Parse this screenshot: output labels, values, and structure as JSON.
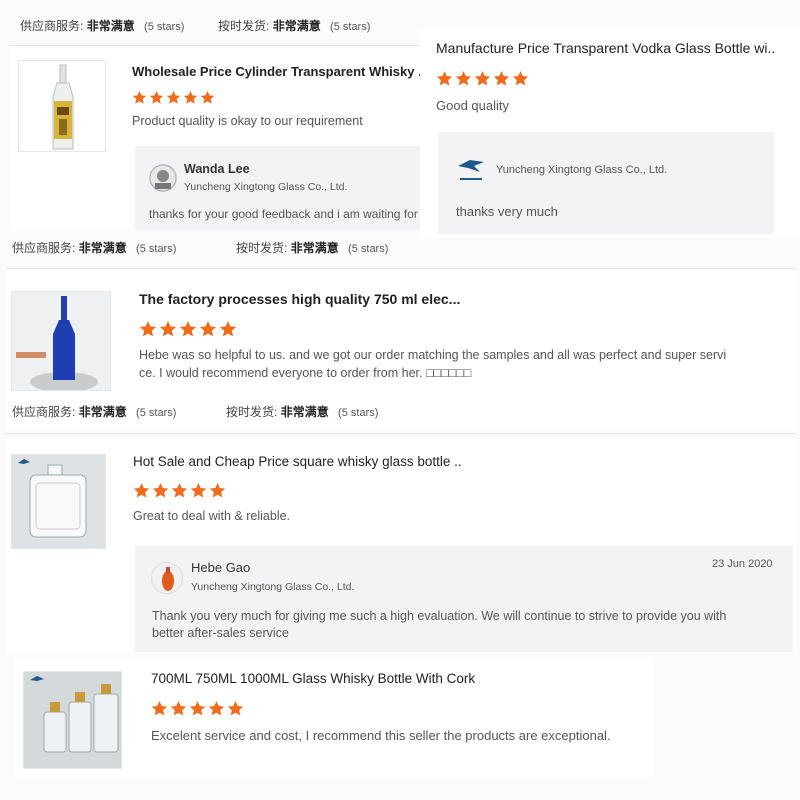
{
  "ratings_bar": {
    "service_label": "供应商服务:",
    "service_value": "非常满意",
    "service_count": "(5 stars)",
    "delivery_label": "按时发货:",
    "delivery_value": "非常满意",
    "delivery_count": "(5 stars)"
  },
  "reviews": [
    {
      "title": "Wholesale Price Cylinder Transparent Whisky ...",
      "rating": 5,
      "text": "Product quality is okay to our requirement",
      "reply": {
        "name": "Wanda Lee",
        "company": "Yuncheng Xingtong Glass Co., Ltd.",
        "text": "thanks for your good feedback and i am waiting for"
      }
    },
    {
      "title": "Manufacture Price Transparent Vodka Glass Bottle wi...",
      "rating": 5,
      "text": "Good quality",
      "reply": {
        "company": "Yuncheng Xingtong Glass Co., Ltd.",
        "text": "thanks very much"
      }
    },
    {
      "title": "The factory processes high quality 750 ml elec...",
      "rating": 5,
      "text_line1": "Hebe was so helpful to us. and we got our order matching the samples and all was perfect and super servi",
      "text_line2": "ce. I would recommend everyone to order from her. □□□□□□"
    },
    {
      "title": "Hot Sale and Cheap Price square whisky glass bottle ...",
      "rating": 5,
      "text": "Great to deal with & reliable.",
      "reply": {
        "name": "Hebe Gao",
        "company": "Yuncheng Xingtong Glass Co., Ltd.",
        "date": "23 Jun 2020",
        "text_line1": "Thank you very much for giving me such a high evaluation. We will continue to strive to provide you with",
        "text_line2": "better after-sales service"
      }
    },
    {
      "title": "700ML 750ML 1000ML Glass Whisky Bottle With Cork",
      "rating": 5,
      "text": "Excelent service and cost, I recommend this seller the products are exceptional."
    }
  ],
  "colors": {
    "star": "#f26b1d",
    "reply_bg": "#f3f3f5",
    "bottle_blue": "#1f3fb0",
    "bottle_amber": "#d8b53a"
  },
  "icons": {
    "star": "star-icon",
    "avatar": "avatar-icon",
    "logo": "company-logo-icon"
  }
}
